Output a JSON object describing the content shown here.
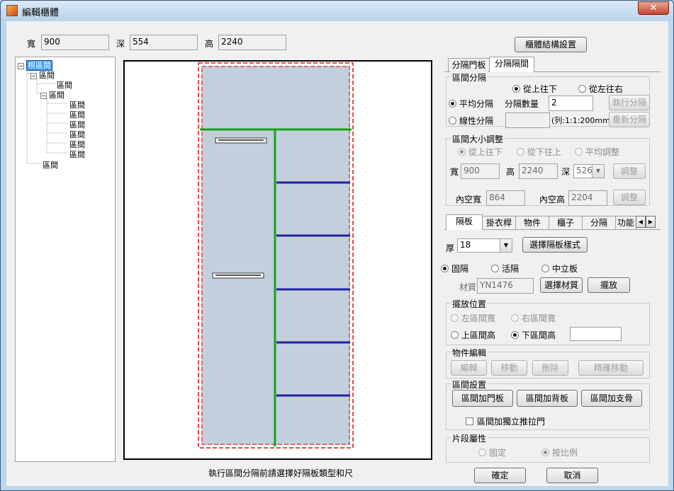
{
  "window": {
    "title": "編輯櫃體",
    "close_label": "✕"
  },
  "dims": {
    "width_label": "寬",
    "width_value": "900",
    "depth_label": "深",
    "depth_value": "554",
    "height_label": "高",
    "height_value": "2240"
  },
  "struct_button": "櫃體結構設置",
  "tree": {
    "root": "根區間",
    "nodes": [
      "區間",
      "區間",
      "區間",
      "區間",
      "區間",
      "區間",
      "區間",
      "區間",
      "區間",
      "區間",
      "區間"
    ]
  },
  "status_text": "執行區間分隔前請選擇好隔板類型和尺",
  "top_tabs": [
    "分隔門板",
    "分隔隔間"
  ],
  "split_group": {
    "title": "區間分隔",
    "top_down": "從上往下",
    "left_right": "從左往右",
    "even": "平均分隔",
    "count_label": "分隔數量",
    "count_value": "2",
    "exec_button": "執行分隔",
    "linear": "線性分隔",
    "linear_hint": "(列:1:1:200mm)",
    "resplit_button": "重新分隔"
  },
  "resize_group": {
    "title": "區間大小調整",
    "top_down": "從上往下",
    "bottom_up": "從下往上",
    "even": "平均調整",
    "w_label": "寬",
    "w_value": "900",
    "h_label": "高",
    "h_value": "2240",
    "d_label": "深",
    "d_value": "526",
    "adjust1": "調整",
    "inner_w_label": "內空寬",
    "inner_w_value": "864",
    "inner_h_label": "內空高",
    "inner_h_value": "2204",
    "adjust2": "調整"
  },
  "sub_tabs": [
    "隔板",
    "掛衣桿",
    "物件",
    "櫃子",
    "分隔",
    "功能"
  ],
  "board": {
    "thick_label": "厚",
    "thick_value": "18",
    "style_button": "選擇隔板樣式",
    "fixed": "固隔",
    "movable": "活隔",
    "vertical": "中立板",
    "material_label": "材質",
    "material_value": "YN1476",
    "material_button": "選擇材質",
    "place_button": "擺放"
  },
  "place_group": {
    "title": "擺放位置",
    "left_w": "左區間寬",
    "right_w": "右區間寬",
    "top_h": "上區間高",
    "bottom_h": "下區間高"
  },
  "edit_group": {
    "title": "物件編輯",
    "edit": "編輯",
    "move": "移動",
    "delete": "刪除",
    "precise": "精確移動"
  },
  "section_group": {
    "title": "區間設置",
    "door": "區間加門板",
    "back": "區間加背板",
    "support": "區間加支骨",
    "sliding": "區間加獨立推拉門"
  },
  "segment_group": {
    "title": "片段屬性",
    "fixed": "固定",
    "ratio": "按比例"
  },
  "ok_button": "確定",
  "cancel_button": "取消",
  "colors": {
    "panel": "#c3cfdc",
    "shelf": "#1f1fa8",
    "divider": "#18a018",
    "boundary": "#e01010"
  }
}
